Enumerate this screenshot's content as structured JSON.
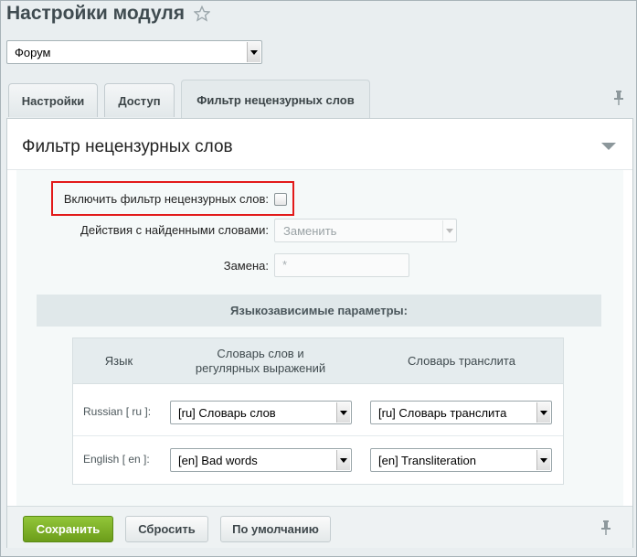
{
  "header": {
    "title": "Настройки модуля"
  },
  "module_select": {
    "value": "Форум"
  },
  "tabs": [
    {
      "label": "Настройки"
    },
    {
      "label": "Доступ"
    },
    {
      "label": "Фильтр нецензурных слов"
    }
  ],
  "section": {
    "title": "Фильтр нецензурных слов",
    "enable_filter_label": "Включить фильтр нецензурных слов:",
    "enable_filter_checked": false,
    "action_label": "Действия с найденными словами:",
    "action_value": "Заменить",
    "replace_label": "Замена:",
    "replace_value": "*",
    "lang_params_title": "Языкозависимые параметры:"
  },
  "lang_table": {
    "headers": {
      "language": "Язык",
      "dictionary_line1": "Словарь слов и",
      "dictionary_line2": "регулярных выражений",
      "translit": "Словарь транслита"
    },
    "rows": [
      {
        "language": "Russian [ ru ]:",
        "dictionary": "[ru] Словарь слов",
        "translit": "[ru] Словарь транслита"
      },
      {
        "language": "English [ en ]:",
        "dictionary": "[en] Bad words",
        "translit": "[en] Transliteration"
      }
    ]
  },
  "footer": {
    "save_label": "Сохранить",
    "reset_label": "Сбросить",
    "default_label": "По умолчанию"
  },
  "colors": {
    "accent_green": "#7cb02a",
    "highlight_red": "#e21a1a"
  }
}
